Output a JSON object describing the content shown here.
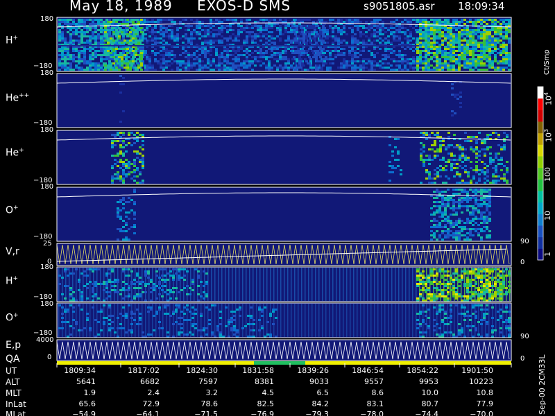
{
  "header": {
    "date": "May 18, 1989",
    "mission": "EXOS-D SMS",
    "filename": "s9051805.asr",
    "time": "18:09:34"
  },
  "panels": [
    {
      "species": "H",
      "charge": "+",
      "top": "180",
      "bottom": "−180"
    },
    {
      "species": "He",
      "charge": "++",
      "top": "180",
      "bottom": "−180"
    },
    {
      "species": "He",
      "charge": "+",
      "top": "180",
      "bottom": "−180"
    },
    {
      "species": "O",
      "charge": "+",
      "top": "180",
      "bottom": "−180"
    },
    {
      "species": "V,r",
      "charge": "",
      "top": "25",
      "bottom": "0",
      "right_top": "90",
      "right_bottom": "0"
    },
    {
      "species": "H",
      "charge": "+",
      "top": "180",
      "bottom": "−180"
    },
    {
      "species": "O",
      "charge": "+",
      "top": "180",
      "bottom": "−180"
    },
    {
      "species": "E,p",
      "charge": "",
      "top": "4000",
      "bottom": "0",
      "right_top": "90",
      "right_bottom": "0"
    }
  ],
  "qa_label": "QA",
  "colorbar": {
    "title": "Ct/Smp",
    "ticks": [
      "1",
      "10",
      "100",
      "10",
      "10"
    ],
    "exp_ticks": [
      {
        "base": "10",
        "exp": "3"
      },
      {
        "base": "10",
        "exp": "4"
      }
    ],
    "plain_ticks": [
      "1",
      "10",
      "100"
    ]
  },
  "footer_version": "Sep-00  2CM33L",
  "ephemeris": {
    "rows": [
      {
        "label": "UT",
        "values": [
          "1809:34",
          "1817:02",
          "1824:30",
          "1831:58",
          "1839:26",
          "1846:54",
          "1854:22",
          "1901:50"
        ]
      },
      {
        "label": "ALT",
        "values": [
          "5641",
          "6682",
          "7597",
          "8381",
          "9033",
          "9557",
          "9953",
          "10223"
        ]
      },
      {
        "label": "MLT",
        "values": [
          "1.9",
          "2.4",
          "3.2",
          "4.5",
          "6.5",
          "8.6",
          "10.0",
          "10.8"
        ]
      },
      {
        "label": "InLat",
        "values": [
          "65.6",
          "72.9",
          "78.6",
          "82.5",
          "84.2",
          "83.1",
          "80.7",
          "77.9"
        ]
      },
      {
        "label": "MLat",
        "values": [
          "−54.9",
          "−64.1",
          "−71.5",
          "−76.9",
          "−79.3",
          "−78.0",
          "−74.4",
          "−70.0"
        ]
      }
    ]
  },
  "chart_data": {
    "type": "heatmap",
    "title": "May 18, 1989   EXOS-D SMS",
    "xlabel": "UT",
    "x_ticks": [
      "1809:34",
      "1817:02",
      "1824:30",
      "1831:58",
      "1839:26",
      "1846:54",
      "1854:22",
      "1901:50"
    ],
    "series": [
      {
        "name": "H+",
        "ylim": [
          -180,
          180
        ]
      },
      {
        "name": "He++",
        "ylim": [
          -180,
          180
        ]
      },
      {
        "name": "He+",
        "ylim": [
          -180,
          180
        ]
      },
      {
        "name": "O+",
        "ylim": [
          -180,
          180
        ]
      },
      {
        "name": "V,r",
        "ylim": [
          0,
          25
        ],
        "ylim_right": [
          0,
          90
        ]
      },
      {
        "name": "H+",
        "ylim": [
          -180,
          180
        ]
      },
      {
        "name": "O+",
        "ylim": [
          -180,
          180
        ]
      },
      {
        "name": "E,p",
        "ylim": [
          0,
          4000
        ],
        "ylim_right": [
          0,
          90
        ]
      }
    ],
    "colorscale": {
      "label": "Ct/Smp",
      "range": [
        1,
        10000
      ],
      "scale": "log"
    },
    "colors": {
      "background": "#111877",
      "low": "#1a3a9a",
      "mid": "#00a0c0",
      "green": "#30c030",
      "yellow": "#e0e000",
      "red": "#e00000",
      "white": "#ffffff",
      "qa_bar": "#f0f000",
      "qa_good": "#20c060"
    }
  }
}
